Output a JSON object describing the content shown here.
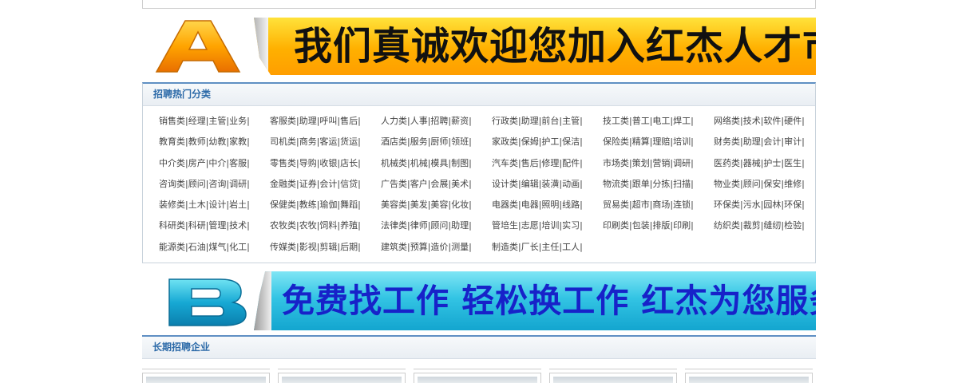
{
  "banner_a": {
    "letter": "A",
    "slogan": "我们真诚欢迎您加入红杰人才市场!"
  },
  "hot_categories": {
    "title": "招聘热门分类",
    "items": [
      "销售类|经理|主管|业务|",
      "客服类|助理|呼叫|售后|",
      "人力类|人事|招聘|薪资|",
      "行政类|助理|前台|主管|",
      "技工类|普工|电工|焊工|",
      "网络类|技术|软件|硬件|",
      "教育类|教师|幼教|家教|",
      "司机类|商务|客运|货运|",
      "酒店类|服务|厨师|领班|",
      "家政类|保姆|护工|保洁|",
      "保险类|精算|理赔|培训|",
      "财务类|助理|会计|审计|",
      "中介类|房产|中介|客服|",
      "零售类|导购|收银|店长|",
      "机械类|机械|模具|制图|",
      "汽车类|售后|修理|配件|",
      "市场类|策划|营销|调研|",
      "医药类|器械|护士|医生|",
      "咨询类|顾问|咨询|调研|",
      "金融类|证券|会计|信贷|",
      "广告类|客户|会展|美术|",
      "设计类|编辑|装潢|动画|",
      "物流类|跟单|分拣|扫描|",
      "物业类|顾问|保安|维修|",
      "装修类|土木|设计|岩土|",
      "保健类|教练|瑜伽|舞蹈|",
      "美容类|美发|美容|化妆|",
      "电器类|电器|照明|线路|",
      "贸易类|超市|商场|连锁|",
      "环保类|污水|园林|环保|",
      "科研类|科研|管理|技术|",
      "农牧类|农牧|饲料|养殖|",
      "法律类|律师|顾问|助理|",
      "管培生|志愿|培训|实习|",
      "印刷类|包装|排版|印刷|",
      "纺织类|裁剪|缝纫|检验|",
      "能源类|石油|煤气|化工|",
      "传媒类|影视|剪辑|后期|",
      "建筑类|预算|造价|测量|",
      "制造类|厂长|主任|工人|"
    ]
  },
  "banner_b": {
    "letter": "B",
    "slogan": "免费找工作 轻松换工作 红杰为您服务"
  },
  "long_term": {
    "title": "长期招聘企业",
    "companies": [
      "",
      "",
      "",
      "",
      "",
      ""
    ]
  },
  "colors": {
    "accent": "#2c6aa8",
    "banner_a_bg": "#ffb000",
    "banner_b_bg": "#33c4e4",
    "banner_b_text": "#1722c9"
  }
}
